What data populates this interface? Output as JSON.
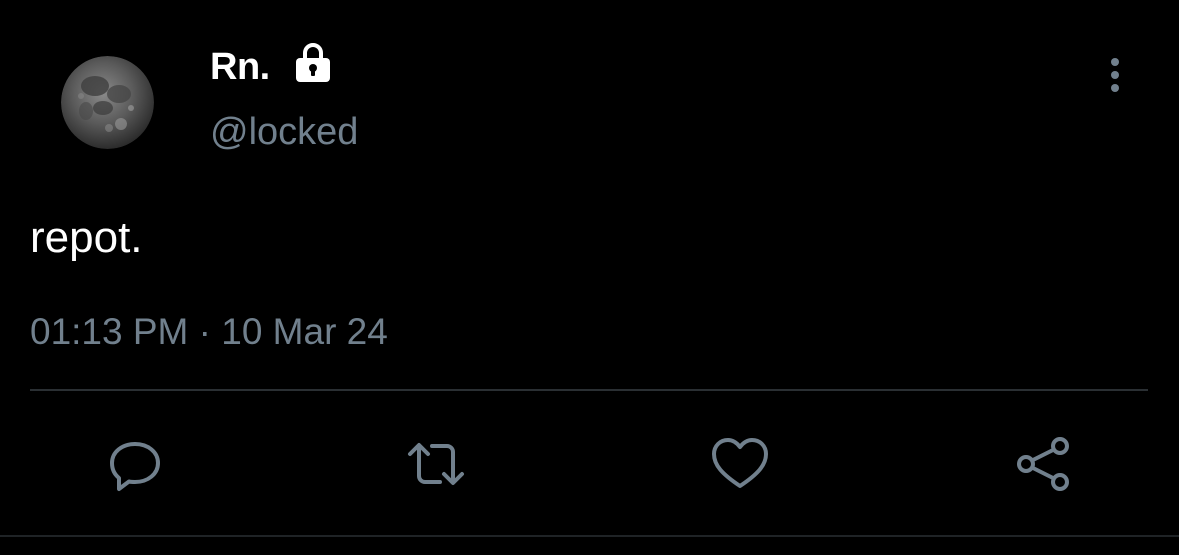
{
  "tweet": {
    "author": {
      "display_name": "Rn.",
      "handle": "@locked",
      "avatar": "moon-avatar",
      "locked_icon": "lock-icon"
    },
    "text": "repot.",
    "timestamp": "01:13 PM · 10 Mar 24"
  },
  "actions": [
    {
      "name": "reply",
      "icon": "comment-icon"
    },
    {
      "name": "retweet",
      "icon": "retweet-icon"
    },
    {
      "name": "like",
      "icon": "heart-icon"
    },
    {
      "name": "share",
      "icon": "share-icon"
    }
  ],
  "menu": {
    "icon": "more-vertical-icon"
  },
  "colors": {
    "background": "#000000",
    "primary_text": "#ffffff",
    "secondary_text": "#71808d",
    "icon": "#71808d",
    "divider": "#2a2f33"
  }
}
